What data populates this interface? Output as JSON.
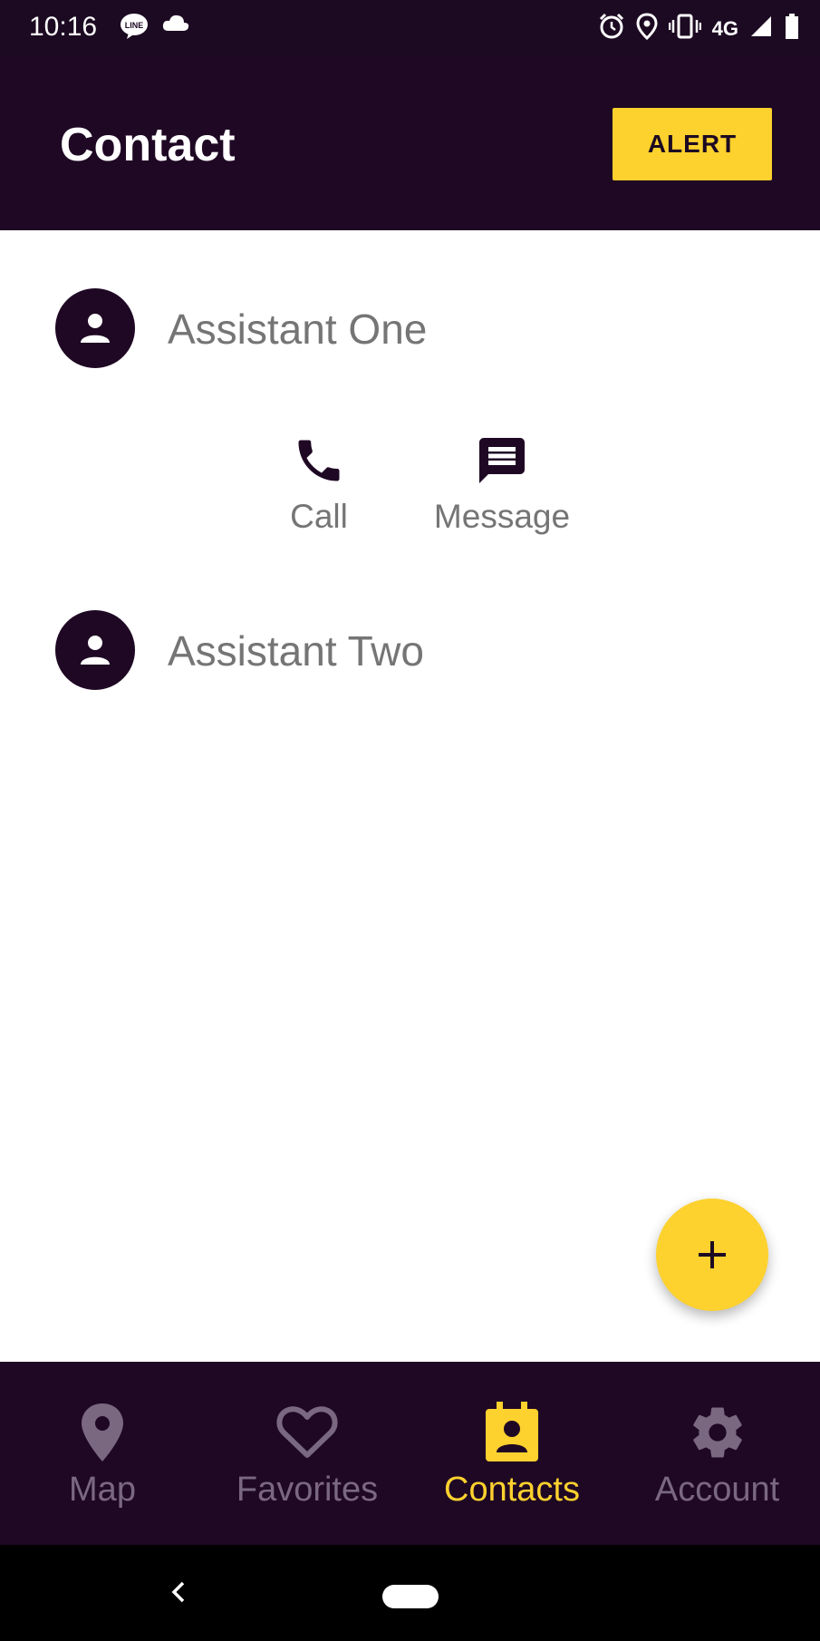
{
  "status_bar": {
    "time": "10:16",
    "left_icons": [
      "line-app-icon",
      "cloud-icon"
    ],
    "right_icons": [
      "alarm-icon",
      "location-icon",
      "vibrate-icon",
      "signal-icon",
      "battery-icon"
    ],
    "network": "4G"
  },
  "app_bar": {
    "title": "Contact",
    "alert_label": "ALERT"
  },
  "contacts": [
    {
      "name": "Assistant One",
      "expanded": true,
      "actions": [
        {
          "label": "Call",
          "icon": "phone-icon"
        },
        {
          "label": "Message",
          "icon": "message-icon"
        }
      ]
    },
    {
      "name": "Assistant Two",
      "expanded": false
    }
  ],
  "fab": {
    "icon": "plus-icon"
  },
  "bottom_nav": {
    "items": [
      {
        "label": "Map",
        "icon": "map-pin-icon",
        "active": false
      },
      {
        "label": "Favorites",
        "icon": "heart-icon",
        "active": false
      },
      {
        "label": "Contacts",
        "icon": "contacts-icon",
        "active": true
      },
      {
        "label": "Account",
        "icon": "gear-icon",
        "active": false
      }
    ]
  },
  "colors": {
    "primary_dark": "#1f0824",
    "accent": "#fdd12e",
    "muted_text": "#757575",
    "nav_inactive": "#7a6880"
  }
}
